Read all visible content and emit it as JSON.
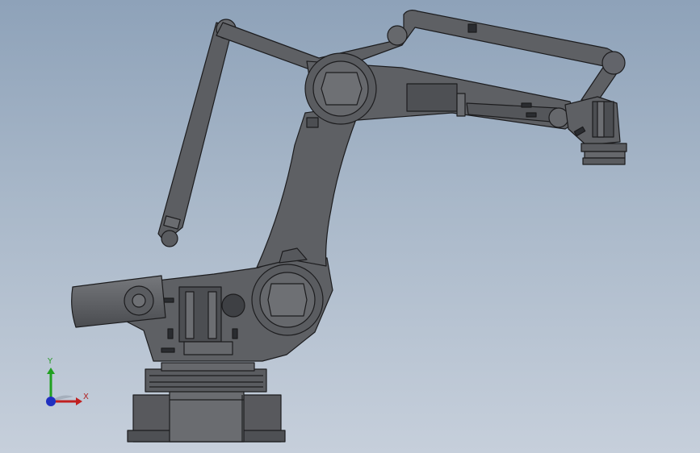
{
  "viewport": {
    "background_top": "#8ea2b9",
    "background_bottom": "#c6cfdb"
  },
  "model": {
    "body_color": "#5e6064",
    "edge_color": "#1c1c1e",
    "highlight_color": "#8a8c90",
    "dark_color": "#44464a"
  },
  "triad": {
    "x_label": "X",
    "y_label": "Y",
    "x_color": "#c02020",
    "y_color": "#20a020",
    "z_color": "#2030c0"
  }
}
